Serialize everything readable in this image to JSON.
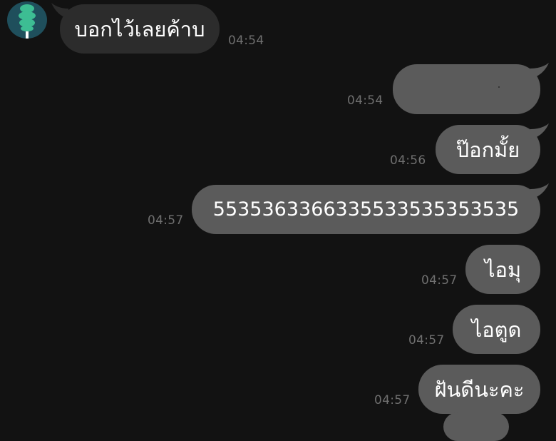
{
  "chat": {
    "colors": {
      "background": "#121212",
      "incoming_bubble": "#2c2c2c",
      "outgoing_bubble": "#5b5b5b",
      "avatar_bg": "#1f4f5c",
      "avatar_icon": "#3dbd93",
      "timestamp": "#6f6f6f"
    },
    "contact": {
      "avatar_icon": "green-tree-icon"
    },
    "messages": [
      {
        "direction": "incoming",
        "text": "บอกไว้เลยค้าบ",
        "time": "04:54"
      },
      {
        "direction": "outgoing",
        "text": "",
        "time": "04:54"
      },
      {
        "direction": "outgoing",
        "text": "ป๊อกมั้ย",
        "time": "04:56"
      },
      {
        "direction": "outgoing",
        "text": "5535363366335533535353535",
        "time": "04:57"
      },
      {
        "direction": "outgoing",
        "text": "ไอมุ",
        "time": "04:57"
      },
      {
        "direction": "outgoing",
        "text": "ไอตูด",
        "time": "04:57"
      },
      {
        "direction": "outgoing",
        "text": "ฝันดีนะคะ",
        "time": "04:57"
      }
    ]
  }
}
